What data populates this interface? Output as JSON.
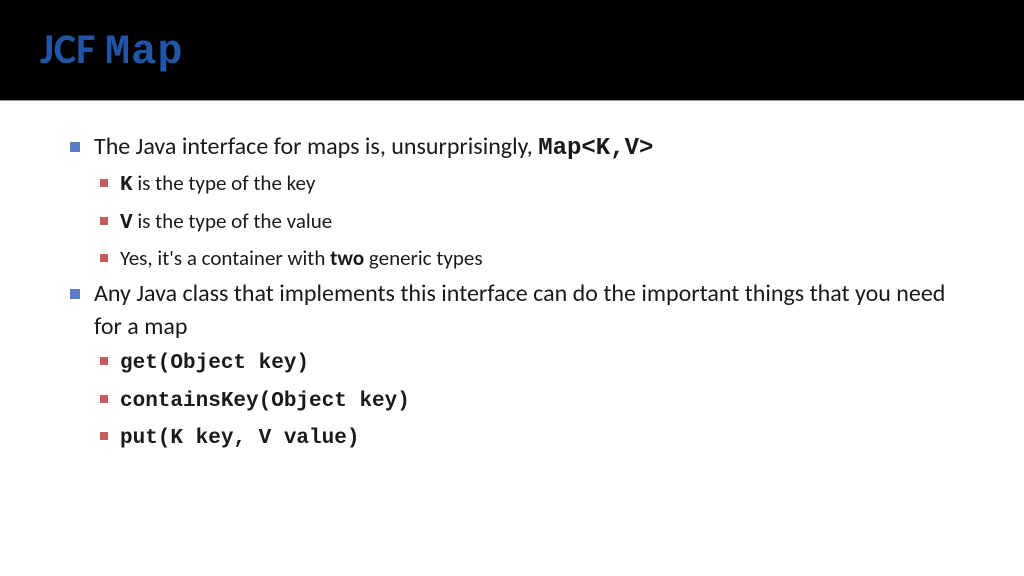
{
  "header": {
    "title_prefix": "JCF ",
    "title_code": "Map"
  },
  "bullets": {
    "b1_pre": "The Java interface for maps is, unsurprisingly, ",
    "b1_code": "Map<K,V>",
    "b1_sub1_code": "K",
    "b1_sub1_text": " is the type of the key",
    "b1_sub2_code": "V",
    "b1_sub2_text": " is the type of the value",
    "b1_sub3_pre": "Yes, it's a container with ",
    "b1_sub3_bold": "two",
    "b1_sub3_post": " generic types",
    "b2_text": "Any Java class that implements this interface can do the important things that you need for a map",
    "b2_sub1": "get(Object key)",
    "b2_sub2": "containsKey(Object key)",
    "b2_sub3": "put(K key, V value)"
  }
}
